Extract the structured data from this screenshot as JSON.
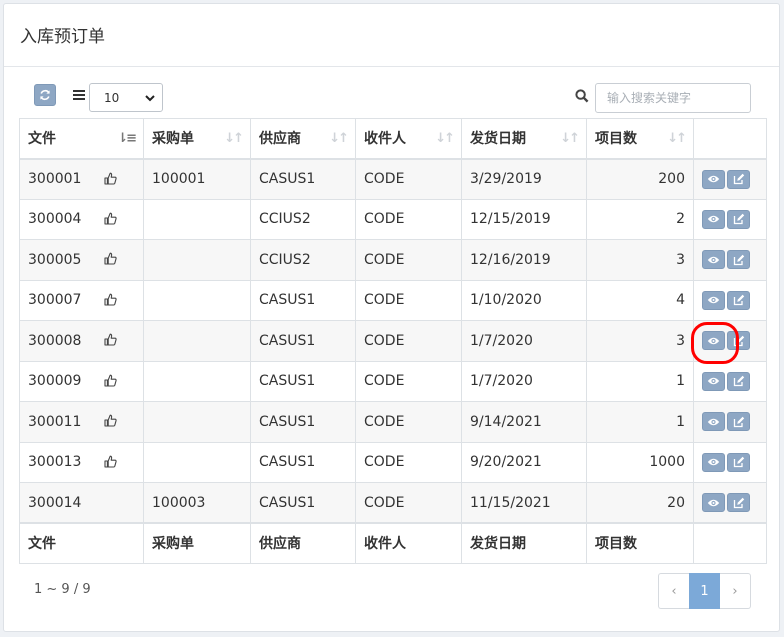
{
  "page": {
    "title": "入库预订单"
  },
  "toolbar": {
    "refresh_icon": "refresh-icon",
    "page_size": "10",
    "search_placeholder": "输入搜索关键字"
  },
  "table": {
    "columns": [
      "文件",
      "采购单",
      "供应商",
      "收件人",
      "发货日期",
      "项目数"
    ],
    "rows": [
      {
        "file": "300001",
        "po": "100001",
        "supplier": "CASUS1",
        "recipient": "CODE",
        "date": "3/29/2019",
        "items": "200",
        "thumb": true
      },
      {
        "file": "300004",
        "po": "",
        "supplier": "CCIUS2",
        "recipient": "CODE",
        "date": "12/15/2019",
        "items": "2",
        "thumb": true
      },
      {
        "file": "300005",
        "po": "",
        "supplier": "CCIUS2",
        "recipient": "CODE",
        "date": "12/16/2019",
        "items": "3",
        "thumb": true
      },
      {
        "file": "300007",
        "po": "",
        "supplier": "CASUS1",
        "recipient": "CODE",
        "date": "1/10/2020",
        "items": "4",
        "thumb": true
      },
      {
        "file": "300008",
        "po": "",
        "supplier": "CASUS1",
        "recipient": "CODE",
        "date": "1/7/2020",
        "items": "3",
        "thumb": true
      },
      {
        "file": "300009",
        "po": "",
        "supplier": "CASUS1",
        "recipient": "CODE",
        "date": "1/7/2020",
        "items": "1",
        "thumb": true
      },
      {
        "file": "300011",
        "po": "",
        "supplier": "CASUS1",
        "recipient": "CODE",
        "date": "9/14/2021",
        "items": "1",
        "thumb": true
      },
      {
        "file": "300013",
        "po": "",
        "supplier": "CASUS1",
        "recipient": "CODE",
        "date": "9/20/2021",
        "items": "1000",
        "thumb": true
      },
      {
        "file": "300014",
        "po": "100003",
        "supplier": "CASUS1",
        "recipient": "CODE",
        "date": "11/15/2021",
        "items": "20",
        "thumb": false
      }
    ]
  },
  "footer": {
    "range": "1 ~ 9 / 9",
    "prev": "‹",
    "current_page": "1",
    "next": "›"
  },
  "colors": {
    "button": "#8ea7c4",
    "active_page": "#7ca9d8",
    "highlight": "#ff0000"
  }
}
